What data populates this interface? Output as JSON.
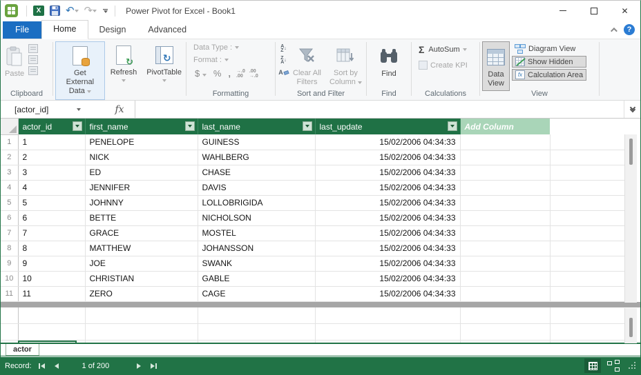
{
  "titlebar": {
    "title": "Power Pivot for Excel - Book1"
  },
  "tabs": {
    "file": "File",
    "home": "Home",
    "design": "Design",
    "advanced": "Advanced"
  },
  "ribbon": {
    "clipboard": {
      "paste": "Paste",
      "label": "Clipboard"
    },
    "data_group": {
      "get_external_line1": "Get External",
      "get_external_line2": "Data",
      "refresh": "Refresh",
      "pivottable": "PivotTable"
    },
    "formatting": {
      "data_type": "Data Type :",
      "format": "Format :",
      "label": "Formatting"
    },
    "sort_filter": {
      "clear_all_line1": "Clear All",
      "clear_all_line2": "Filters",
      "sort_by_line1": "Sort by",
      "sort_by_line2": "Column",
      "label": "Sort and Filter"
    },
    "find": {
      "button": "Find",
      "label": "Find"
    },
    "calculations": {
      "autosum": "AutoSum",
      "create_kpi": "Create KPI",
      "label": "Calculations"
    },
    "view": {
      "data_view_line1": "Data",
      "data_view_line2": "View",
      "diagram_view": "Diagram View",
      "show_hidden": "Show Hidden",
      "calculation_area": "Calculation Area",
      "label": "View"
    }
  },
  "formula_bar": {
    "name_box": "[actor_id]",
    "fx": "fx",
    "value": ""
  },
  "grid": {
    "columns": [
      "actor_id",
      "first_name",
      "last_name",
      "last_update"
    ],
    "add_column": "Add Column",
    "rows": [
      {
        "n": "1",
        "cells": [
          "1",
          "PENELOPE",
          "GUINESS",
          "15/02/2006 04:34:33"
        ]
      },
      {
        "n": "2",
        "cells": [
          "2",
          "NICK",
          "WAHLBERG",
          "15/02/2006 04:34:33"
        ]
      },
      {
        "n": "3",
        "cells": [
          "3",
          "ED",
          "CHASE",
          "15/02/2006 04:34:33"
        ]
      },
      {
        "n": "4",
        "cells": [
          "4",
          "JENNIFER",
          "DAVIS",
          "15/02/2006 04:34:33"
        ]
      },
      {
        "n": "5",
        "cells": [
          "5",
          "JOHNNY",
          "LOLLOBRIGIDA",
          "15/02/2006 04:34:33"
        ]
      },
      {
        "n": "6",
        "cells": [
          "6",
          "BETTE",
          "NICHOLSON",
          "15/02/2006 04:34:33"
        ]
      },
      {
        "n": "7",
        "cells": [
          "7",
          "GRACE",
          "MOSTEL",
          "15/02/2006 04:34:33"
        ]
      },
      {
        "n": "8",
        "cells": [
          "8",
          "MATTHEW",
          "JOHANSSON",
          "15/02/2006 04:34:33"
        ]
      },
      {
        "n": "9",
        "cells": [
          "9",
          "JOE",
          "SWANK",
          "15/02/2006 04:34:33"
        ]
      },
      {
        "n": "10",
        "cells": [
          "10",
          "CHRISTIAN",
          "GABLE",
          "15/02/2006 04:34:33"
        ]
      },
      {
        "n": "11",
        "cells": [
          "11",
          "ZERO",
          "CAGE",
          "15/02/2006 04:34:33"
        ]
      }
    ]
  },
  "sheet_tab": "actor",
  "status": {
    "record": "Record:",
    "position": "1 of 200"
  },
  "icons": {
    "excel": "X",
    "help": "?",
    "close": "✕",
    "undo": "↶",
    "redo": "↷",
    "sigma": "Σ",
    "dollar": "$",
    "percent": "%",
    "comma": ",",
    "inc_top": "→.0",
    "inc_bot": ".00",
    "dec_top": ".00",
    "dec_bot": "→.0",
    "a": "A",
    "z": "Z",
    "arrow_down": "↓",
    "fx_small": "fx",
    "refresh_glyph": "↻",
    "pivot_arrow": "↻"
  },
  "colors": {
    "accent_green": "#217346",
    "header_green": "#1f7145",
    "add_column_bg": "#a9d5b8",
    "file_tab_blue": "#1b6ec2",
    "splitter_gray": "#a6a6a6"
  }
}
